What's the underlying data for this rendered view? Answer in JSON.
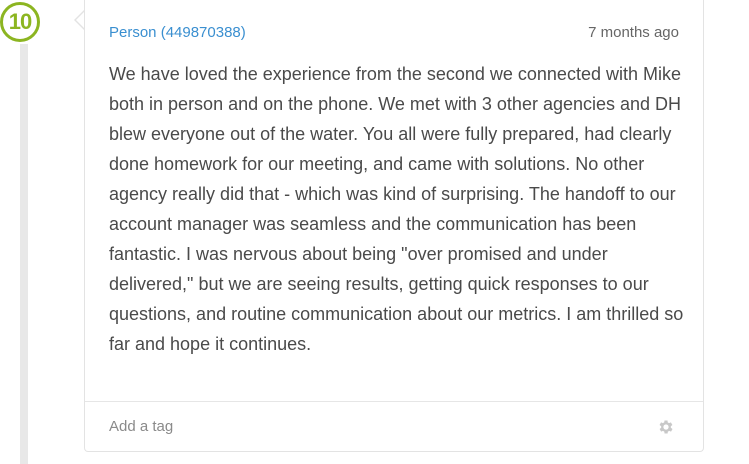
{
  "entry": {
    "number": "10"
  },
  "review": {
    "author": "Person (449870388)",
    "timestamp": "7 months ago",
    "text": "We have loved the experience from the second we connected with Mike both in person and on the phone. We met with 3 other agencies and DH blew everyone out of the water. You all were fully prepared, had clearly done homework for our meeting, and came with solutions. No other agency really did that - which was kind of surprising. The handoff to our account manager was seamless and the communication has been fantastic. I was nervous about being \"over promised and under delivered,\" but we are seeing results, getting quick responses to our questions, and routine communication about our metrics. I am thrilled so far and hope it continues."
  },
  "footer": {
    "add_tag_label": "Add a tag",
    "settings_icon": "gear-icon"
  },
  "colors": {
    "accent_green": "#8cb521",
    "link_blue": "#3a8fd0",
    "body_text": "#4a4a4a",
    "muted_text": "#8a8a8a"
  }
}
